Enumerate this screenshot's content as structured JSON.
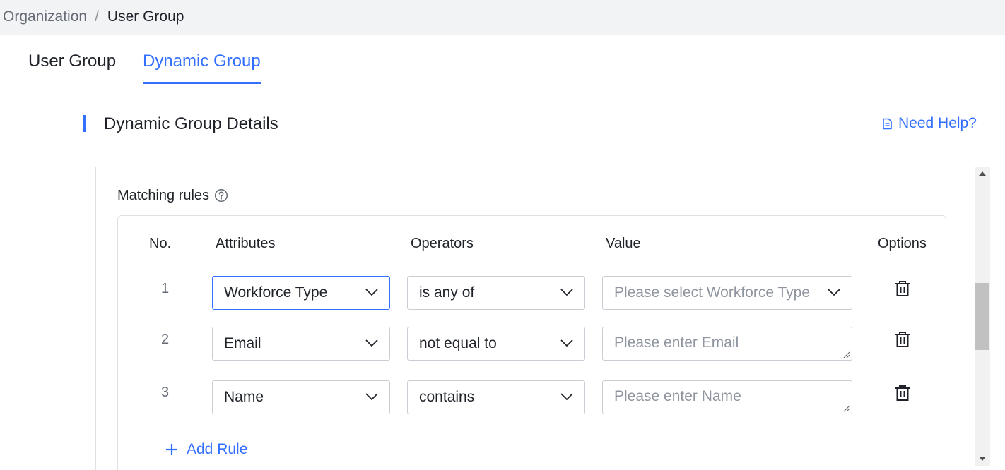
{
  "breadcrumb": {
    "parent": "Organization",
    "separator": "/",
    "current": "User Group"
  },
  "tabs": [
    {
      "label": "User Group",
      "active": false
    },
    {
      "label": "Dynamic Group",
      "active": true
    }
  ],
  "section": {
    "title": "Dynamic Group Details",
    "help_label": "Need Help?"
  },
  "rules": {
    "label": "Matching rules",
    "headers": {
      "no": "No.",
      "attributes": "Attributes",
      "operators": "Operators",
      "value": "Value",
      "options": "Options"
    },
    "rows": [
      {
        "no": "1",
        "attribute": "Workforce Type",
        "operator": "is any of",
        "value_placeholder": "Please select Workforce Type",
        "value_type": "select"
      },
      {
        "no": "2",
        "attribute": "Email",
        "operator": "not equal to",
        "value_placeholder": "Please enter Email",
        "value_type": "textarea"
      },
      {
        "no": "3",
        "attribute": "Name",
        "operator": "contains",
        "value_placeholder": "Please enter Name",
        "value_type": "textarea"
      }
    ],
    "add_label": "Add Rule"
  },
  "colors": {
    "accent": "#3370ff",
    "border": "#c9cdd4",
    "placeholder": "#8f959e",
    "text": "#1f2329"
  },
  "icons": [
    "doc-icon",
    "question-circle-icon",
    "chevron-down-icon",
    "trash-icon",
    "plus-icon",
    "resize-grip-icon",
    "scroll-up-arrow-icon",
    "scroll-down-arrow-icon"
  ]
}
